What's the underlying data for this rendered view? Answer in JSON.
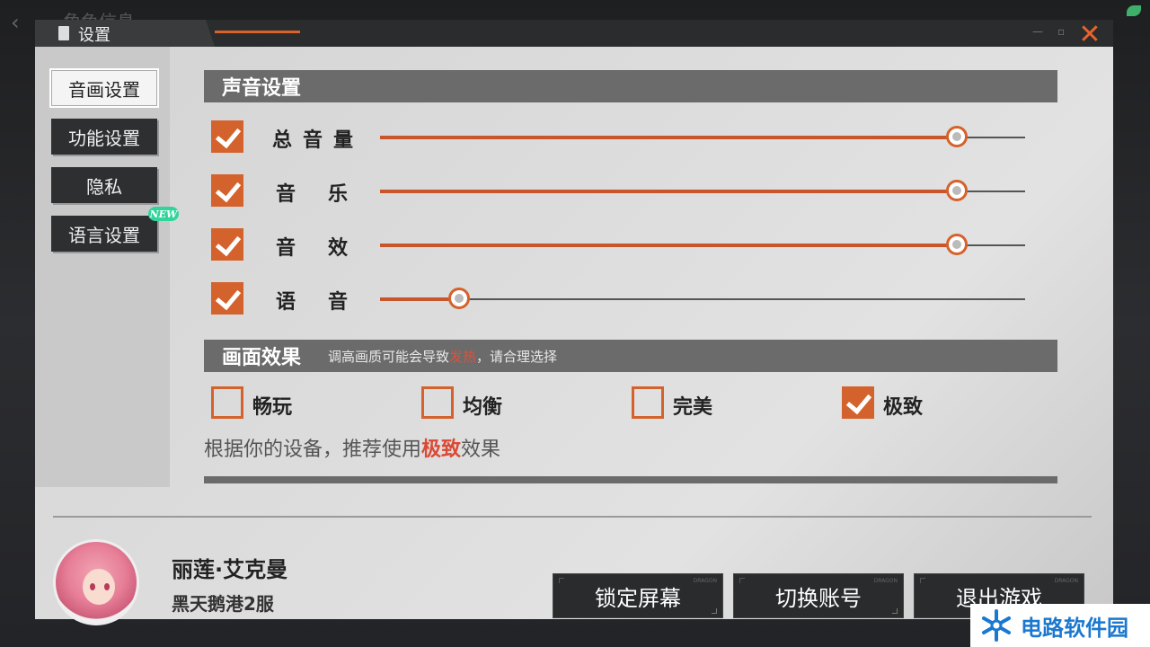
{
  "background": {
    "title": "角色信息"
  },
  "dialog": {
    "title": "设置",
    "close": "✕"
  },
  "sidebar": {
    "items": [
      {
        "label": "音画设置",
        "active": true
      },
      {
        "label": "功能设置",
        "active": false
      },
      {
        "label": "隐私",
        "active": false
      },
      {
        "label": "语言设置",
        "active": false,
        "badge": "NEW"
      }
    ]
  },
  "sound": {
    "header": "声音设置",
    "rows": [
      {
        "label": "总音量",
        "checked": true,
        "level": 0.89
      },
      {
        "label": "音乐",
        "checked": true,
        "level": 0.89
      },
      {
        "label": "音效",
        "checked": true,
        "level": 0.89
      },
      {
        "label": "语音",
        "checked": true,
        "level": 0.12
      }
    ]
  },
  "graphics": {
    "header": "画面效果",
    "hint_prefix": "调高画质可能会导致",
    "hint_warn": "发热",
    "hint_suffix": "，请合理选择",
    "options": [
      {
        "label": "畅玩",
        "checked": false
      },
      {
        "label": "均衡",
        "checked": false
      },
      {
        "label": "完美",
        "checked": false
      },
      {
        "label": "极致",
        "checked": true
      }
    ],
    "recommend_prefix": "根据你的设备，推荐使用",
    "recommend_highlight": "极致",
    "recommend_suffix": "效果"
  },
  "player": {
    "name": "丽莲·艾克曼",
    "server": "黑天鹅港2服"
  },
  "actions": {
    "lock": "锁定屏幕",
    "switch": "切换账号",
    "exit": "退出游戏",
    "tag": "DRAGON"
  },
  "watermark": {
    "text": "电路软件园"
  },
  "colors": {
    "accent": "#d4622c",
    "header": "#6b6b6b",
    "button": "#2a2b2d"
  }
}
